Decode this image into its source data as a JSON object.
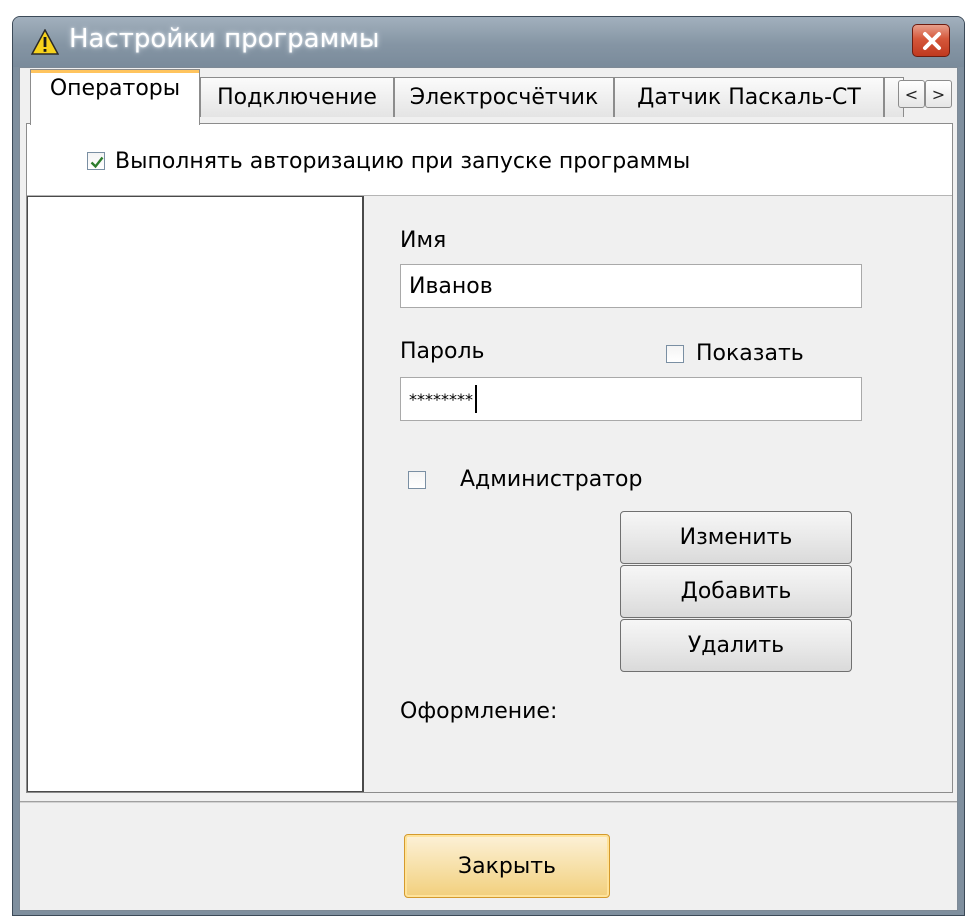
{
  "window": {
    "title": "Настройки программы",
    "icons": {
      "title_icon": "warning-icon",
      "close": "close-icon"
    }
  },
  "tabs": [
    {
      "label": "Операторы",
      "active": true
    },
    {
      "label": "Подключение",
      "active": false
    },
    {
      "label": "Электросчётчик",
      "active": false
    },
    {
      "label": "Датчик Паскаль-СТ",
      "active": false
    }
  ],
  "tab_scroll": {
    "left": "<",
    "right": ">"
  },
  "auth": {
    "label": "Выполнять авторизацию при запуске программы",
    "checked": true
  },
  "form": {
    "name_label": "Имя",
    "name_value": "Иванов",
    "password_label": "Пароль",
    "password_value": "********",
    "show_label": "Показать",
    "show_checked": false,
    "admin_label": "Администратор",
    "admin_checked": false,
    "appearance_label": "Оформление:"
  },
  "buttons": {
    "edit": "Изменить",
    "add": "Добавить",
    "delete": "Удалить",
    "close": "Закрыть"
  },
  "colors": {
    "titlebar": "#8595a4",
    "close_button": "#d5573a",
    "default_button": "#f7e1aa",
    "check_mark": "#2d7d2d"
  }
}
